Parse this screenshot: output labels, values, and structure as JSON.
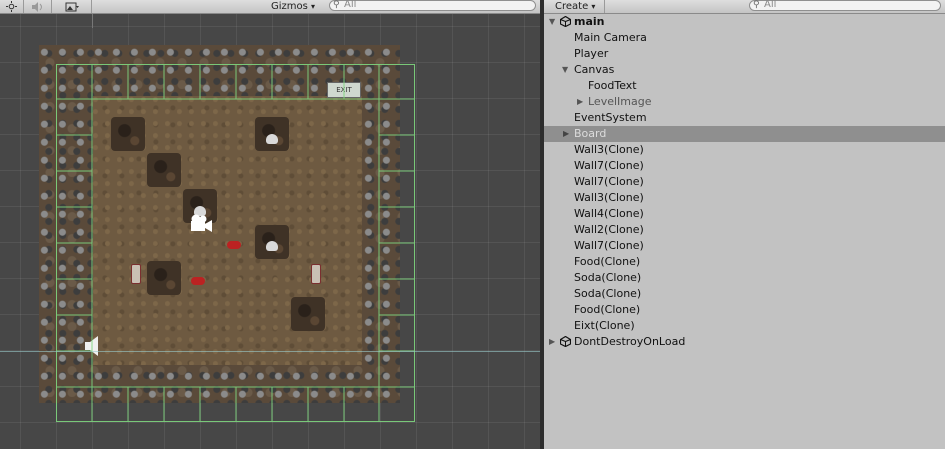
{
  "scene_view": {
    "toolbar": {
      "gizmos_label": "Gizmos",
      "gizmos_arrow": "▾",
      "search_placeholder": "All",
      "icons": [
        "sun-icon",
        "speaker-icon",
        "image-icon"
      ]
    },
    "exit_sign_text": "EXIT"
  },
  "hierarchy": {
    "toolbar": {
      "create_label": "Create",
      "create_arrow": "▾",
      "search_placeholder": "All"
    },
    "items": [
      {
        "label": "main",
        "expanded": true,
        "unity_icon": true,
        "scene_root": true
      },
      {
        "label": "Main Camera"
      },
      {
        "label": "Player"
      },
      {
        "label": "Canvas",
        "expanded": true
      },
      {
        "label": "FoodText"
      },
      {
        "label": "LevelImage",
        "collapsed": true,
        "muted": true
      },
      {
        "label": "EventSystem"
      },
      {
        "label": "Board",
        "collapsed": true,
        "selected": true
      },
      {
        "label": "Wall3(Clone)"
      },
      {
        "label": "Wall7(Clone)"
      },
      {
        "label": "Wall7(Clone)"
      },
      {
        "label": "Wall3(Clone)"
      },
      {
        "label": "Wall4(Clone)"
      },
      {
        "label": "Wall2(Clone)"
      },
      {
        "label": "Wall7(Clone)"
      },
      {
        "label": "Food(Clone)"
      },
      {
        "label": "Soda(Clone)"
      },
      {
        "label": "Soda(Clone)"
      },
      {
        "label": "Food(Clone)"
      },
      {
        "label": "Eixt(Clone)"
      },
      {
        "label": "DontDestroyOnLoad",
        "collapsed": true,
        "unity_icon": true
      }
    ]
  },
  "colors": {
    "hierarchy_bg": "#c2c2c2",
    "selected_row": "#8f8f8f",
    "grid_line": "#7fd67f",
    "scene_bg": "#474747"
  }
}
